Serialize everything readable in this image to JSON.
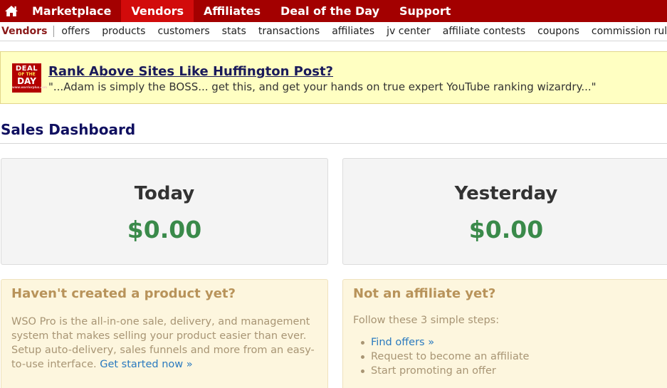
{
  "topnav": {
    "items": [
      {
        "label": "Marketplace"
      },
      {
        "label": "Vendors",
        "active": true
      },
      {
        "label": "Affiliates"
      },
      {
        "label": "Deal of the Day"
      },
      {
        "label": "Support"
      }
    ]
  },
  "subnav": {
    "section": "Vendors",
    "items": [
      "offers",
      "products",
      "customers",
      "stats",
      "transactions",
      "affiliates",
      "jv center",
      "affiliate contests",
      "coupons",
      "commission rules"
    ]
  },
  "banner": {
    "logo": {
      "line1": "DEAL",
      "line2": "OF THE",
      "line3": "DAY",
      "line4": "www.warriorplus.com"
    },
    "title": "Rank Above Sites Like Huffington Post?",
    "quote": "\"...Adam is simply the BOSS... get this, and get your hands on true expert YouTube ranking wizardry...\""
  },
  "dashboard": {
    "title": "Sales Dashboard",
    "today": {
      "label": "Today",
      "value": "$0.00"
    },
    "yesterday": {
      "label": "Yesterday",
      "value": "$0.00"
    }
  },
  "product_box": {
    "title": "Haven't created a product yet?",
    "text": "WSO Pro is the all-in-one sale, delivery, and management system that makes selling your product easier than ever. Setup auto-delivery, sales funnels and more from an easy-to-use interface.",
    "link": "Get started now »"
  },
  "affiliate_box": {
    "title": "Not an affiliate yet?",
    "intro": "Follow these 3 simple steps:",
    "step1_link": "Find offers »",
    "step2": "Request to become an affiliate",
    "step3": "Start promoting an offer"
  },
  "colors": {
    "nav_bg": "#a30000",
    "nav_active": "#d20b0b",
    "money_green": "#3a8a4a",
    "link_blue": "#2a7abf"
  }
}
